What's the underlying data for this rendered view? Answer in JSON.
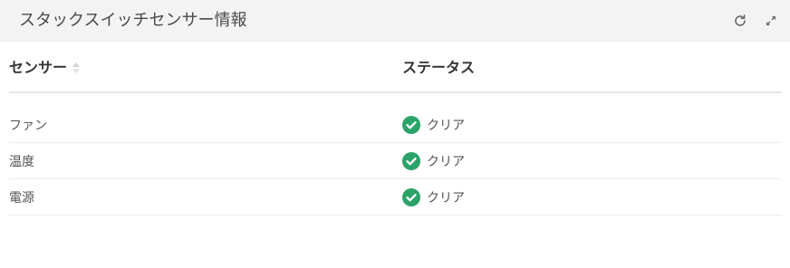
{
  "panel": {
    "title": "スタックスイッチセンサー情報",
    "icons": [
      "refresh-icon",
      "expand-icon"
    ]
  },
  "table": {
    "headers": {
      "sensor": "センサー",
      "status": "ステータス"
    },
    "rows": [
      {
        "sensor": "ファン",
        "status": "クリア",
        "status_icon": "check-circle-icon"
      },
      {
        "sensor": "温度",
        "status": "クリア",
        "status_icon": "check-circle-icon"
      },
      {
        "sensor": "電源",
        "status": "クリア",
        "status_icon": "check-circle-icon"
      }
    ]
  },
  "colors": {
    "status_ok": "#2ba36a",
    "header_bg": "#f3f3f3"
  }
}
